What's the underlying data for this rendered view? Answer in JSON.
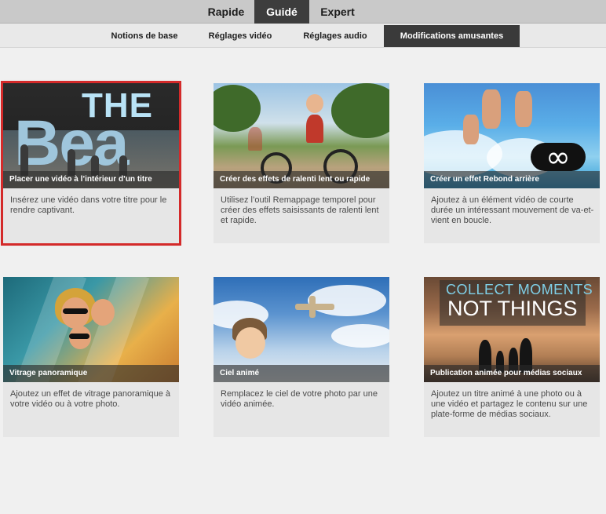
{
  "modes": [
    "Rapide",
    "Guidé",
    "Expert"
  ],
  "active_mode": "Guidé",
  "subtabs": [
    "Notions de base",
    "Réglages vidéo",
    "Réglages audio",
    "Modifications amusantes"
  ],
  "active_subtab": "Modifications amusantes",
  "cards": [
    {
      "caption": "Placer une vidéo à l’intérieur d’un titre",
      "description": "Insérez une vidéo dans votre titre pour le rendre captivant.",
      "thumb_text": [
        "THE",
        "Bea"
      ],
      "selected": true
    },
    {
      "caption": "Créer des effets de ralenti lent ou rapide",
      "description": "Utilisez l’outil Remappage temporel pour créer des effets saisissants de ralenti lent et rapide."
    },
    {
      "caption": "Créer un effet Rebond arrière",
      "description": "Ajoutez à un élément vidéo de courte durée un intéressant mouvement de va-et-vient en boucle.",
      "thumb_icon": "infinity-loop-icon"
    },
    {
      "caption": "Vitrage panoramique",
      "description": "Ajoutez un effet de vitrage panoramique à votre vidéo ou à votre photo."
    },
    {
      "caption": "Ciel animé",
      "description": "Remplacez le ciel de votre photo par une vidéo animée."
    },
    {
      "caption": "Publication animée pour médias sociaux",
      "description": "Ajoutez un titre animé à une photo ou à une vidéo et partagez le contenu sur une plate-forme de médias sociaux.",
      "thumb_text": [
        "COLLECT MOMENTS",
        "NOT THINGS"
      ]
    }
  ],
  "colors": {
    "accent_selected": "#d42a2a",
    "active_tab_bg": "#3d3d3d",
    "bar_bg": "#c9c9c9"
  }
}
